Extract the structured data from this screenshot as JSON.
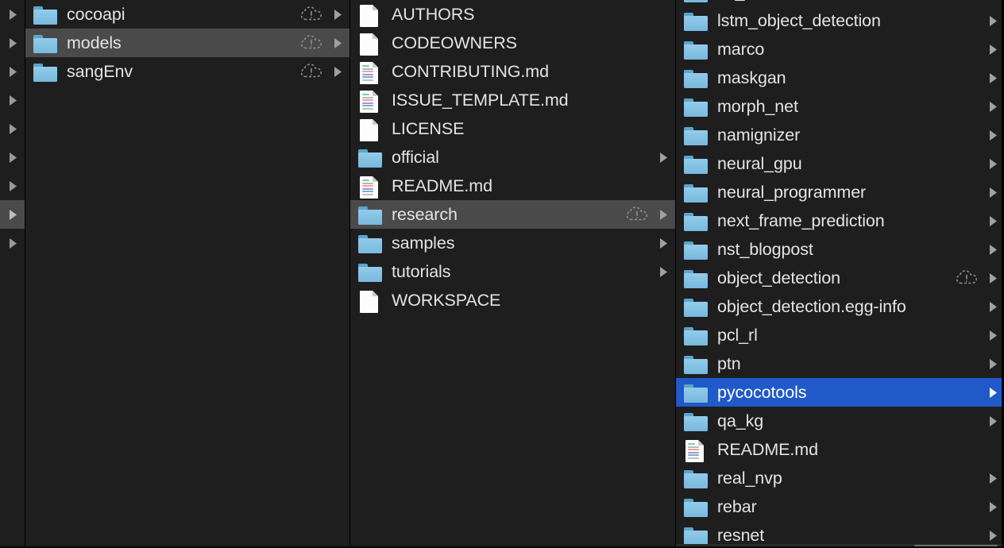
{
  "window": {
    "app": "Finder",
    "view_mode": "column",
    "appearance": "dark",
    "colors": {
      "background": "#1e1e1e",
      "selection_active": "#2059c8",
      "selection_inactive": "#4a4a4a",
      "divider": "#000000",
      "text": "#e4e4e4",
      "text_selected": "#ffffff",
      "folder": "#85c3e4"
    }
  },
  "columns": [
    {
      "name": "parent-column-stub",
      "truncated": true,
      "items": [
        {
          "label": "",
          "icon": "disclosure-triangle-icon",
          "has_chevron": true,
          "selected": false
        },
        {
          "label": "",
          "icon": "disclosure-triangle-icon",
          "has_chevron": true,
          "selected": false
        },
        {
          "label": "",
          "icon": "disclosure-triangle-icon",
          "has_chevron": true,
          "selected": false
        },
        {
          "label": "",
          "icon": "disclosure-triangle-icon",
          "has_chevron": true,
          "selected": false
        },
        {
          "label": "",
          "icon": "disclosure-triangle-icon",
          "has_chevron": true,
          "selected": false
        },
        {
          "label": "",
          "icon": "disclosure-triangle-icon",
          "has_chevron": true,
          "selected": false
        },
        {
          "label": "",
          "icon": "disclosure-triangle-icon",
          "has_chevron": true,
          "selected": false
        },
        {
          "label": "",
          "icon": "disclosure-triangle-icon",
          "has_chevron": true,
          "selected": "inactive"
        },
        {
          "label": "",
          "icon": "disclosure-triangle-icon",
          "has_chevron": true,
          "selected": false
        }
      ]
    },
    {
      "name": "column-models-root",
      "items": [
        {
          "label": "cocoapi",
          "icon": "folder-icon",
          "badge": "cloud-warning-icon",
          "has_chevron": true,
          "selected": false
        },
        {
          "label": "models",
          "icon": "folder-icon",
          "badge": "cloud-warning-icon",
          "has_chevron": true,
          "selected": "inactive"
        },
        {
          "label": "sangEnv",
          "icon": "folder-icon",
          "badge": "cloud-warning-icon",
          "has_chevron": true,
          "selected": false
        }
      ]
    },
    {
      "name": "column-models",
      "items": [
        {
          "label": "AUTHORS",
          "icon": "document-icon",
          "badge": null,
          "has_chevron": false,
          "selected": false
        },
        {
          "label": "CODEOWNERS",
          "icon": "document-icon",
          "badge": null,
          "has_chevron": false,
          "selected": false
        },
        {
          "label": "CONTRIBUTING.md",
          "icon": "markdown-icon",
          "badge": null,
          "has_chevron": false,
          "selected": false
        },
        {
          "label": "ISSUE_TEMPLATE.md",
          "icon": "markdown-icon",
          "badge": null,
          "has_chevron": false,
          "selected": false
        },
        {
          "label": "LICENSE",
          "icon": "document-icon",
          "badge": null,
          "has_chevron": false,
          "selected": false
        },
        {
          "label": "official",
          "icon": "folder-icon",
          "badge": null,
          "has_chevron": true,
          "selected": false
        },
        {
          "label": "README.md",
          "icon": "markdown-icon",
          "badge": null,
          "has_chevron": false,
          "selected": false
        },
        {
          "label": "research",
          "icon": "folder-icon",
          "badge": "cloud-warning-icon",
          "has_chevron": true,
          "selected": "inactive"
        },
        {
          "label": "samples",
          "icon": "folder-icon",
          "badge": null,
          "has_chevron": true,
          "selected": false
        },
        {
          "label": "tutorials",
          "icon": "folder-icon",
          "badge": null,
          "has_chevron": true,
          "selected": false
        },
        {
          "label": "WORKSPACE",
          "icon": "document-icon",
          "badge": null,
          "has_chevron": false,
          "selected": false
        }
      ]
    },
    {
      "name": "column-research",
      "scrolled": true,
      "items": [
        {
          "label": "lm_commonsense",
          "icon": "folder-icon",
          "badge": null,
          "has_chevron": true,
          "selected": false,
          "clipped_top": true
        },
        {
          "label": "lstm_object_detection",
          "icon": "folder-icon",
          "badge": null,
          "has_chevron": true,
          "selected": false
        },
        {
          "label": "marco",
          "icon": "folder-icon",
          "badge": null,
          "has_chevron": true,
          "selected": false
        },
        {
          "label": "maskgan",
          "icon": "folder-icon",
          "badge": null,
          "has_chevron": true,
          "selected": false
        },
        {
          "label": "morph_net",
          "icon": "folder-icon",
          "badge": null,
          "has_chevron": true,
          "selected": false
        },
        {
          "label": "namignizer",
          "icon": "folder-icon",
          "badge": null,
          "has_chevron": true,
          "selected": false
        },
        {
          "label": "neural_gpu",
          "icon": "folder-icon",
          "badge": null,
          "has_chevron": true,
          "selected": false
        },
        {
          "label": "neural_programmer",
          "icon": "folder-icon",
          "badge": null,
          "has_chevron": true,
          "selected": false
        },
        {
          "label": "next_frame_prediction",
          "icon": "folder-icon",
          "badge": null,
          "has_chevron": true,
          "selected": false
        },
        {
          "label": "nst_blogpost",
          "icon": "folder-icon",
          "badge": null,
          "has_chevron": true,
          "selected": false
        },
        {
          "label": "object_detection",
          "icon": "folder-icon",
          "badge": "cloud-warning-icon",
          "has_chevron": true,
          "selected": false
        },
        {
          "label": "object_detection.egg-info",
          "icon": "folder-icon",
          "badge": null,
          "has_chevron": true,
          "selected": false
        },
        {
          "label": "pcl_rl",
          "icon": "folder-icon",
          "badge": null,
          "has_chevron": true,
          "selected": false
        },
        {
          "label": "ptn",
          "icon": "folder-icon",
          "badge": null,
          "has_chevron": true,
          "selected": false
        },
        {
          "label": "pycocotools",
          "icon": "folder-icon",
          "badge": null,
          "has_chevron": true,
          "selected": "active"
        },
        {
          "label": "qa_kg",
          "icon": "folder-icon",
          "badge": null,
          "has_chevron": true,
          "selected": false
        },
        {
          "label": "README.md",
          "icon": "markdown-icon",
          "badge": null,
          "has_chevron": false,
          "selected": false
        },
        {
          "label": "real_nvp",
          "icon": "folder-icon",
          "badge": null,
          "has_chevron": true,
          "selected": false
        },
        {
          "label": "rebar",
          "icon": "folder-icon",
          "badge": null,
          "has_chevron": true,
          "selected": false
        },
        {
          "label": "resnet",
          "icon": "folder-icon",
          "badge": null,
          "has_chevron": true,
          "selected": false,
          "clipped_bottom": true
        }
      ]
    }
  ],
  "scrollbar": {
    "name": "horizontal-scrollbar",
    "visible": true
  }
}
